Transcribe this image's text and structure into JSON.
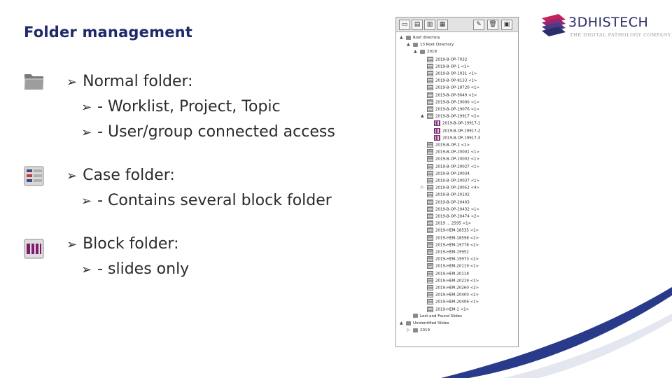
{
  "slide": {
    "title": "Folder management",
    "sections": [
      {
        "icon": "normal-folder-icon",
        "heading": "Normal folder:",
        "items": [
          "- Worklist, Project, Topic",
          "- User/group connected access"
        ]
      },
      {
        "icon": "case-folder-icon",
        "heading": "Case folder:",
        "items": [
          "- Contains several block folder"
        ]
      },
      {
        "icon": "block-folder-icon",
        "heading": "Block folder:",
        "items": [
          "- slides only"
        ]
      }
    ]
  },
  "logo": {
    "name": "3DHISTECH",
    "tagline": "THE DIGITAL PATHOLOGY COMPANY"
  },
  "tree": {
    "toolbar": [
      "new-folder-icon",
      "new-case-icon",
      "new-block-icon",
      "new-slide-icon",
      "edit-icon",
      "delete-icon",
      "properties-icon"
    ],
    "nodes": [
      {
        "label": "Root directory",
        "depth": 0,
        "type": "folder",
        "expander": "▲"
      },
      {
        "label": "13 Root Directory",
        "depth": 1,
        "type": "folder",
        "expander": "▲"
      },
      {
        "label": "2019",
        "depth": 2,
        "type": "folder",
        "expander": "▲"
      },
      {
        "label": "2019-B-OP-7032",
        "depth": 3,
        "type": "case"
      },
      {
        "label": "2019-B-OP-1 <1>",
        "depth": 3,
        "type": "case"
      },
      {
        "label": "2019-B-OP-1031 <1>",
        "depth": 3,
        "type": "case"
      },
      {
        "label": "2019-B-OP-8133 <1>",
        "depth": 3,
        "type": "case"
      },
      {
        "label": "2019-B-OP-18720 <1>",
        "depth": 3,
        "type": "case"
      },
      {
        "label": "2019-B-OP-9049 <2>",
        "depth": 3,
        "type": "case"
      },
      {
        "label": "2019-B-OP-19000 <1>",
        "depth": 3,
        "type": "case"
      },
      {
        "label": "2019-B-OP-19076 <1>",
        "depth": 3,
        "type": "case"
      },
      {
        "label": "2019-B-OP-19917 <2>",
        "depth": 3,
        "type": "case",
        "expander": "▲"
      },
      {
        "label": "2019-B-OP-19917-1",
        "depth": 4,
        "type": "block"
      },
      {
        "label": "2019-B-OP-19917-2",
        "depth": 4,
        "type": "block"
      },
      {
        "label": "2019-B-OP-19917-3",
        "depth": 4,
        "type": "block"
      },
      {
        "label": "2019-B-OP-2 <1>",
        "depth": 3,
        "type": "case"
      },
      {
        "label": "2019-B-OP-20001 <1>",
        "depth": 3,
        "type": "case"
      },
      {
        "label": "2019-B-OP-20002 <1>",
        "depth": 3,
        "type": "case"
      },
      {
        "label": "2019-B-OP-20027 <1>",
        "depth": 3,
        "type": "case"
      },
      {
        "label": "2019-B-OP-20034",
        "depth": 3,
        "type": "case"
      },
      {
        "label": "2019-B-OP-20037 <1>",
        "depth": 3,
        "type": "case"
      },
      {
        "label": "2019-B-OP-20052 <4>",
        "depth": 3,
        "type": "case",
        "expander": "▷"
      },
      {
        "label": "2019-B-OP-20102",
        "depth": 3,
        "type": "case"
      },
      {
        "label": "2019-B-OP-20403",
        "depth": 3,
        "type": "case"
      },
      {
        "label": "2019-B-OP-20432 <1>",
        "depth": 3,
        "type": "case"
      },
      {
        "label": "2019-B-OP-20474 <2>",
        "depth": 3,
        "type": "case"
      },
      {
        "label": "2019 ... 2595 <1>",
        "depth": 3,
        "type": "case"
      },
      {
        "label": "2019-HEM-18535 <1>",
        "depth": 3,
        "type": "case"
      },
      {
        "label": "2019-HEM-18598 <2>",
        "depth": 3,
        "type": "case"
      },
      {
        "label": "2019-HEM-19778 <2>",
        "depth": 3,
        "type": "case"
      },
      {
        "label": "2019-HEM-19952",
        "depth": 3,
        "type": "case"
      },
      {
        "label": "2019-HEM-19973 <2>",
        "depth": 3,
        "type": "case"
      },
      {
        "label": "2019-HEM-20119 <1>",
        "depth": 3,
        "type": "case"
      },
      {
        "label": "2019-HEM-20118",
        "depth": 3,
        "type": "case"
      },
      {
        "label": "2019-HEM-20219 <1>",
        "depth": 3,
        "type": "case"
      },
      {
        "label": "2019-HEM-20260 <2>",
        "depth": 3,
        "type": "case"
      },
      {
        "label": "2019-HEM-20400 <2>",
        "depth": 3,
        "type": "case"
      },
      {
        "label": "2019-HEM-20406 <1>",
        "depth": 3,
        "type": "case"
      },
      {
        "label": "2019-HEM-1 <1>",
        "depth": 3,
        "type": "case"
      },
      {
        "label": "Lost and Found Slides",
        "depth": 1,
        "type": "folder"
      },
      {
        "label": "Unidentified Slides",
        "depth": 0,
        "type": "folder",
        "expander": "▲"
      },
      {
        "label": "2019",
        "depth": 1,
        "type": "folder",
        "expander": "▷"
      }
    ]
  }
}
